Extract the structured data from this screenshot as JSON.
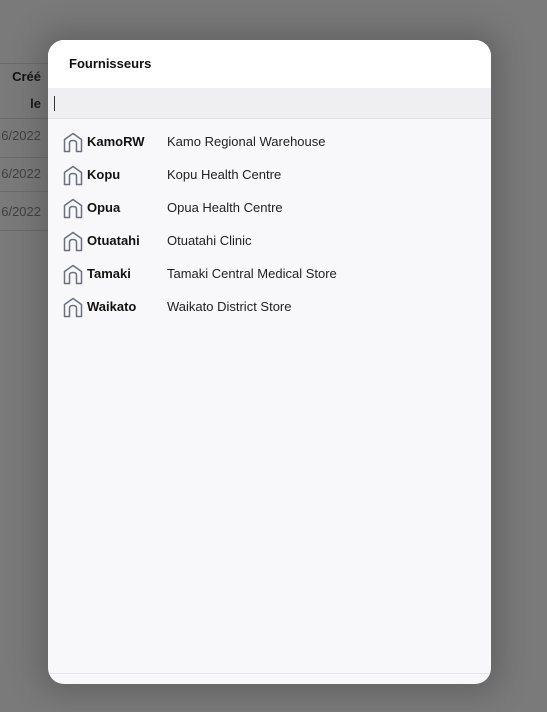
{
  "background": {
    "column_header": {
      "line1": "Créé",
      "line2": "le"
    },
    "rows": [
      "6/2022",
      "6/2022",
      "6/2022"
    ]
  },
  "modal": {
    "title": "Fournisseurs",
    "search": {
      "value": "",
      "placeholder": ""
    },
    "items": [
      {
        "code": "KamoRW",
        "name": "Kamo Regional Warehouse",
        "icon": "store-icon"
      },
      {
        "code": "Kopu",
        "name": "Kopu Health Centre",
        "icon": "store-icon"
      },
      {
        "code": "Opua",
        "name": "Opua Health Centre",
        "icon": "store-icon"
      },
      {
        "code": "Otuatahi",
        "name": "Otuatahi Clinic",
        "icon": "store-icon"
      },
      {
        "code": "Tamaki",
        "name": "Tamaki Central Medical Store",
        "icon": "store-icon"
      },
      {
        "code": "Waikato",
        "name": "Waikato District Store",
        "icon": "store-icon"
      }
    ]
  },
  "colors": {
    "overlay": "#7a7a7a",
    "modal_bg": "#f8f8fa",
    "icon_stroke": "#6b6f80"
  }
}
